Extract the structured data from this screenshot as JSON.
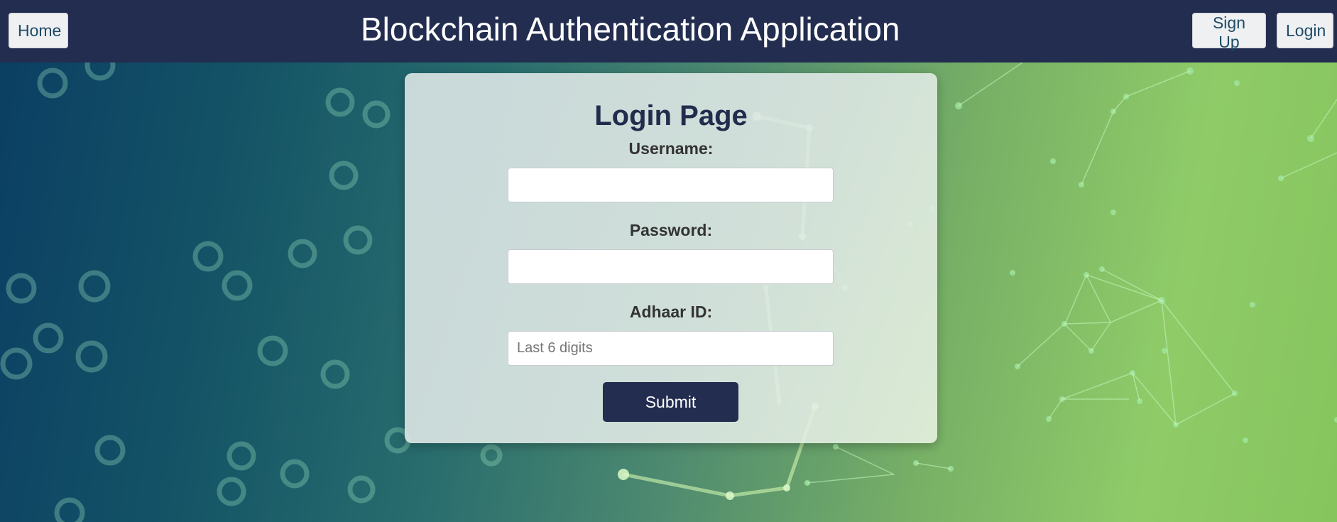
{
  "header": {
    "title": "Blockchain Authentication Application",
    "home_label": "Home",
    "signup_label": "Sign Up",
    "login_label": "Login"
  },
  "form": {
    "title": "Login Page",
    "username_label": "Username:",
    "username_value": "",
    "password_label": "Password:",
    "password_value": "",
    "adhaar_label": "Adhaar ID:",
    "adhaar_value": "",
    "adhaar_placeholder": "Last 6 digits",
    "submit_label": "Submit"
  },
  "colors": {
    "navbar": "#232d50",
    "submit_button": "#232d50",
    "title_text": "#222c4c",
    "background_left": "#0b3f63",
    "background_right": "#8fcc68"
  }
}
